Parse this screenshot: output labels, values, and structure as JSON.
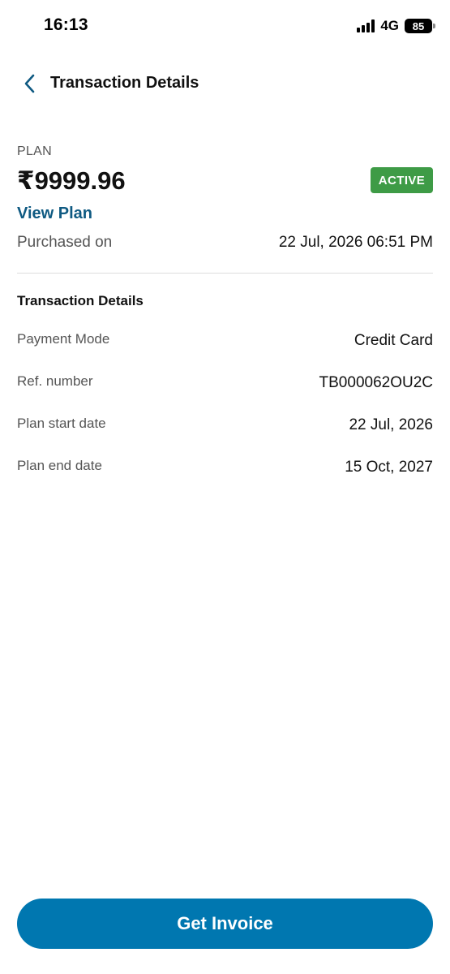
{
  "status_bar": {
    "time": "16:13",
    "network": "4G",
    "battery": "85"
  },
  "header": {
    "back_icon": "chevron-left-icon",
    "title": "Transaction Details"
  },
  "plan": {
    "label": "PLAN",
    "amount": "₹9999.96",
    "status": "ACTIVE",
    "status_color": "#3e9b46",
    "view_plan_label": "View Plan",
    "link_color": "#0f5a82",
    "purchased_label": "Purchased on",
    "purchased_value": "22 Jul, 2026 06:51 PM"
  },
  "details": {
    "title": "Transaction Details",
    "rows": [
      {
        "label": "Payment Mode",
        "value": "Credit Card"
      },
      {
        "label": "Ref. number",
        "value": "TB000062OU2C"
      },
      {
        "label": "Plan start date",
        "value": "22 Jul, 2026"
      },
      {
        "label": "Plan end date",
        "value": "15 Oct, 2027"
      }
    ]
  },
  "footer": {
    "invoice_label": "Get Invoice",
    "button_color": "#0077b0"
  }
}
